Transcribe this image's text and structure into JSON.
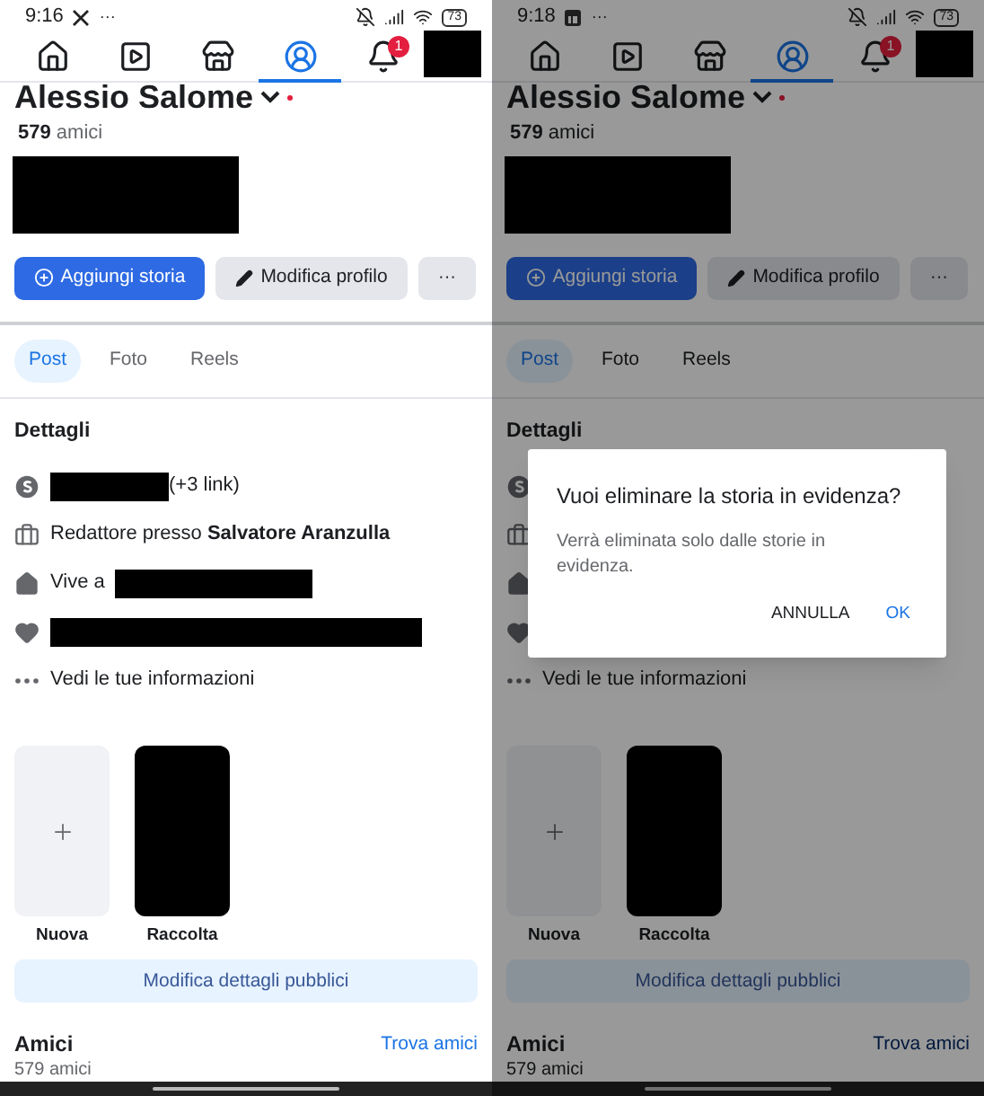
{
  "screens": [
    {
      "status_bar": {
        "time": "9:16",
        "notification": {
          "kind": "x-app"
        },
        "overflow": "···",
        "battery": "73"
      },
      "nav": [
        {
          "kind": "home",
          "selected": false
        },
        {
          "kind": "video",
          "selected": false
        },
        {
          "kind": "store",
          "selected": false
        },
        {
          "kind": "profile",
          "selected": true
        },
        {
          "kind": "notifications",
          "selected": false,
          "badge": "1"
        }
      ],
      "profile": {
        "name": "Alessio Salome",
        "friends_count": "579",
        "friends_label": "amici"
      },
      "actions": [
        {
          "label": "Aggiungi storia",
          "kind": "primary"
        },
        {
          "label": "Modifica profilo",
          "kind": "secondary"
        },
        {
          "label": "···",
          "kind": "more"
        }
      ],
      "tabs": [
        {
          "label": "Post",
          "selected": true
        },
        {
          "label": "Foto",
          "selected": false
        },
        {
          "label": "Reels",
          "selected": false
        }
      ],
      "details_title": "Dettagli",
      "details": [
        {
          "kind": "link",
          "parts": [
            {
              "kind": "redacted"
            },
            {
              "kind": "text",
              "text": "(+3 link)"
            }
          ]
        },
        {
          "kind": "work",
          "parts": [
            {
              "kind": "text",
              "text": "Redattore presso **Salvatore Aranzulla**"
            }
          ]
        },
        {
          "kind": "home",
          "parts": [
            {
              "kind": "text",
              "text": "Vive a"
            },
            {
              "kind": "redacted"
            }
          ]
        },
        {
          "kind": "relationship",
          "parts": [
            {
              "kind": "redacted"
            }
          ]
        },
        {
          "kind": "more",
          "parts": [
            {
              "kind": "text",
              "text": "Vedi le tue informazioni"
            }
          ]
        }
      ],
      "highlights": [
        {
          "kind": "new",
          "label": "Nuova"
        },
        {
          "kind": "redacted",
          "label": "Raccolta"
        }
      ],
      "edit_public": "Modifica dettagli pubblici",
      "friends": {
        "title": "Amici",
        "link": "Trova amici",
        "count": "579 amici"
      },
      "dimmed": false
    },
    {
      "status_bar": {
        "time": "9:18",
        "notification": {
          "kind": "square-app"
        },
        "overflow": "···",
        "battery": "73"
      },
      "nav": [
        {
          "kind": "home",
          "selected": false
        },
        {
          "kind": "video",
          "selected": false
        },
        {
          "kind": "store",
          "selected": false
        },
        {
          "kind": "profile",
          "selected": true
        },
        {
          "kind": "notifications",
          "selected": false,
          "badge": "1"
        }
      ],
      "profile": {
        "name": "Alessio Salome",
        "friends_count": "579",
        "friends_label": "amici"
      },
      "actions": [
        {
          "label": "Aggiungi storia",
          "kind": "primary"
        },
        {
          "label": "Modifica profilo",
          "kind": "secondary"
        },
        {
          "label": "···",
          "kind": "more"
        }
      ],
      "tabs": [
        {
          "label": "Post",
          "selected": true
        },
        {
          "label": "Foto",
          "selected": false
        },
        {
          "label": "Reels",
          "selected": false
        }
      ],
      "details_title": "Dettagli",
      "details": [
        {
          "kind": "link"
        },
        {
          "kind": "work"
        },
        {
          "kind": "home"
        },
        {
          "kind": "relationship"
        },
        {
          "kind": "more",
          "parts": [
            {
              "kind": "text",
              "text": "Vedi le tue informazioni"
            }
          ]
        }
      ],
      "highlights": [
        {
          "kind": "new",
          "label": "Nuova"
        },
        {
          "kind": "redacted",
          "label": "Raccolta"
        }
      ],
      "edit_public": "Modifica dettagli pubblici",
      "friends": {
        "title": "Amici",
        "link": "Trova amici",
        "count": "579 amici"
      },
      "dimmed": true,
      "dialog": {
        "title": "Vuoi eliminare la storia in evidenza?",
        "message": "Verrà eliminata solo dalle storie in evidenza.",
        "buttons": [
          {
            "label": "ANNULLA",
            "kind": "cancel"
          },
          {
            "label": "OK",
            "kind": "confirm"
          }
        ]
      }
    }
  ]
}
